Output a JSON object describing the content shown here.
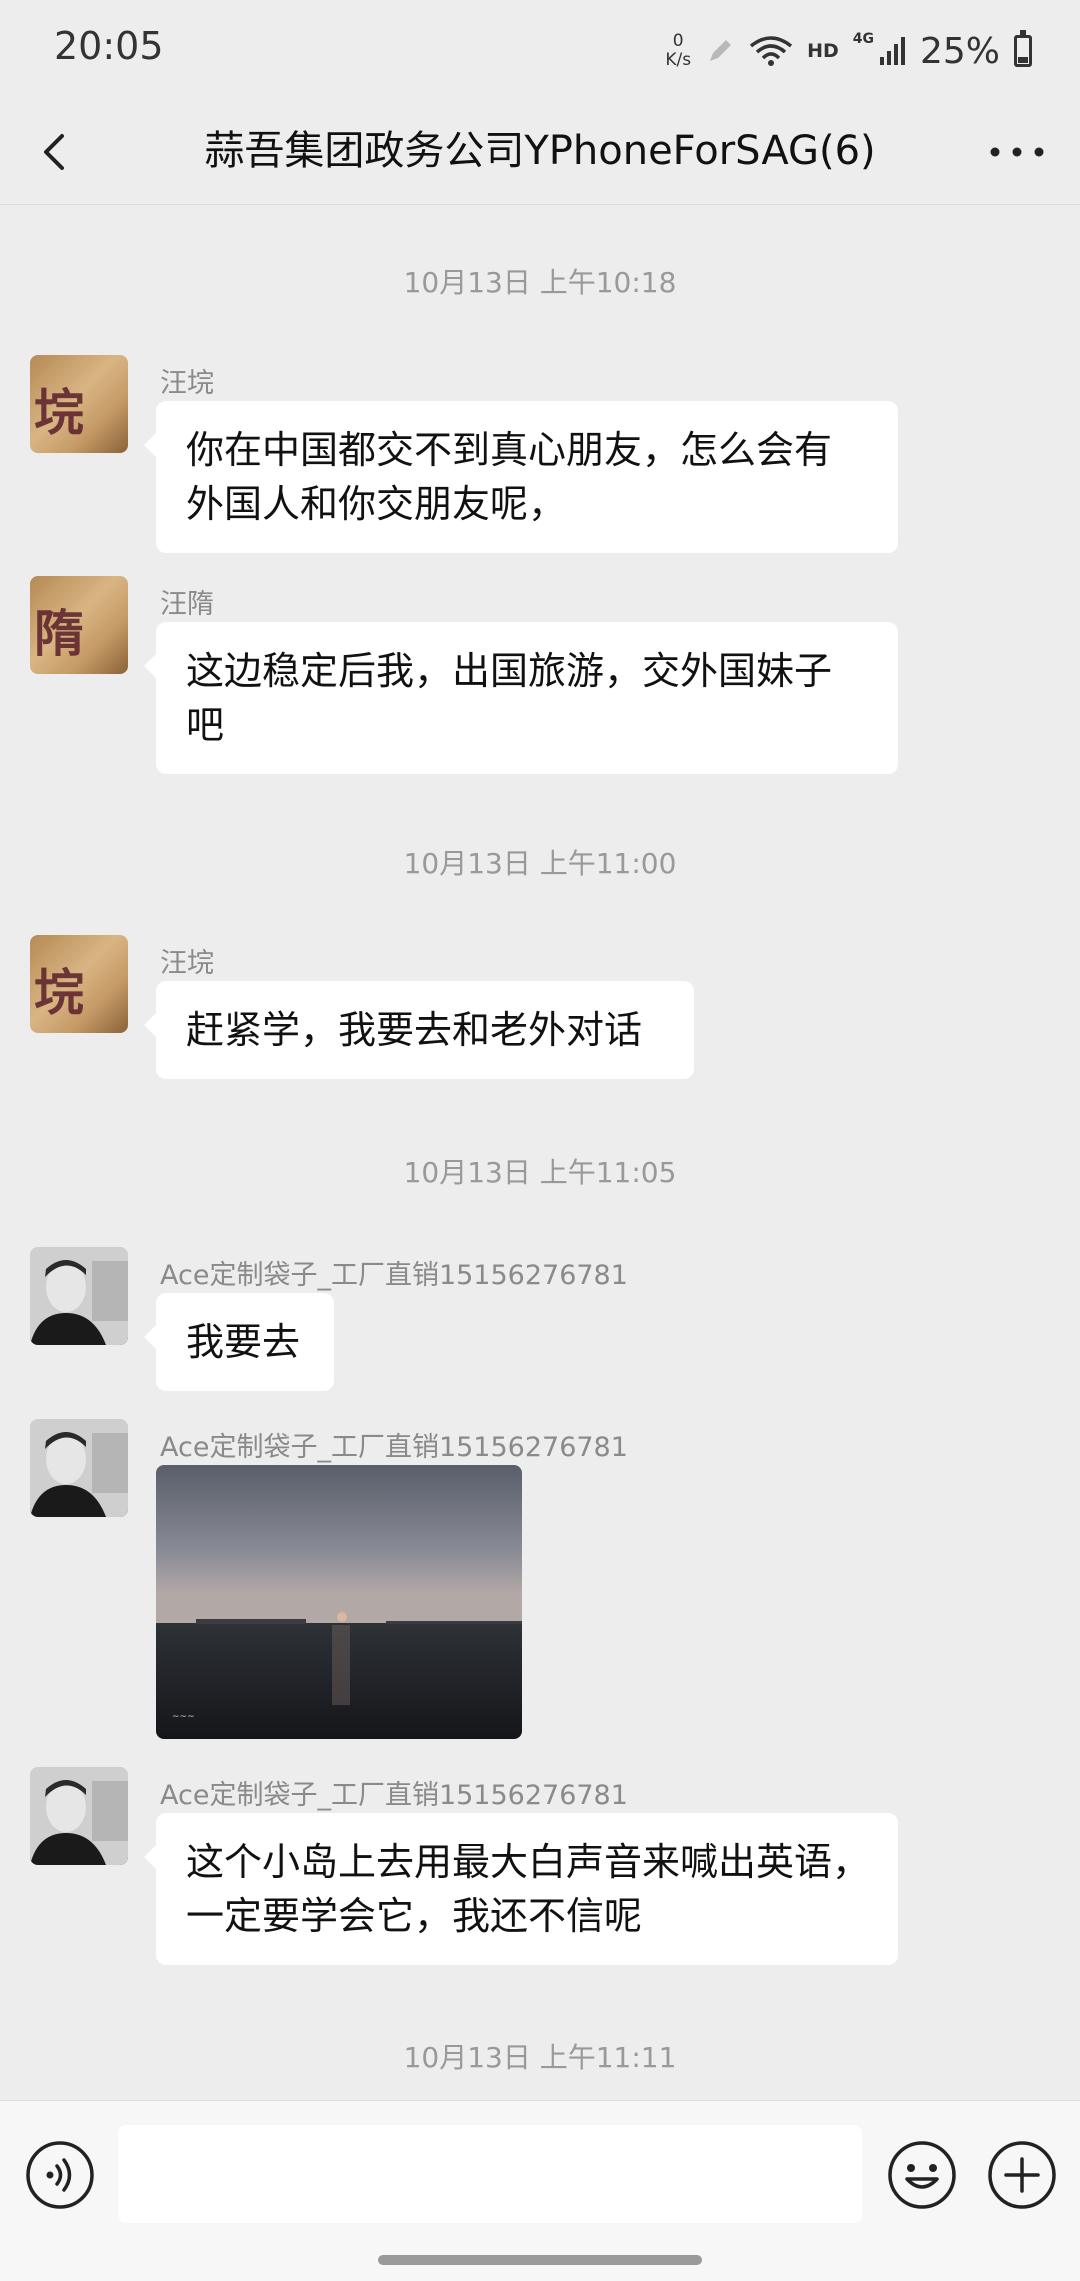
{
  "status_bar": {
    "time": "20:05",
    "net_speed_value": "0",
    "net_speed_unit": "K/s",
    "hd": "HD",
    "network": "4G",
    "battery": "25%",
    "battery_level": 0.25
  },
  "header": {
    "title": "蒜吾集团政务公司YPhoneForSAG(6)"
  },
  "messages": {
    "ts1": "10月13日 上午10:18",
    "m1": {
      "sender": "汪垸",
      "avatar_char": "垸",
      "text_lines": [
        "你在中国都交不到真心朋友，怎么会有",
        "外国人和你交朋友呢，"
      ]
    },
    "m2": {
      "sender": "汪隋",
      "avatar_char": "隋",
      "text_lines": [
        "这边稳定后我，出国旅游，交外国妹子",
        "吧"
      ]
    },
    "ts2": "10月13日 上午11:00",
    "m3": {
      "sender": "汪垸",
      "avatar_char": "垸",
      "text": "赶紧学，我要去和老外对话"
    },
    "ts3": "10月13日 上午11:05",
    "m4": {
      "sender": "Ace定制袋子_工厂直销15156276781",
      "text": "我要去"
    },
    "m5": {
      "sender": "Ace定制袋子_工厂直销15156276781"
    },
    "m6": {
      "sender": "Ace定制袋子_工厂直销15156276781",
      "text_lines": [
        "这个小岛上去用最大白声音来喊出英语，",
        "一定要学会它，我还不信呢"
      ]
    },
    "ts4": "10月13日 上午11:11"
  },
  "input": {
    "value": "",
    "placeholder": ""
  },
  "icons": {
    "back": "back-arrow-icon",
    "more": "more-dots-icon",
    "voice": "voice-icon",
    "emoji": "emoji-icon",
    "add": "plus-icon"
  }
}
